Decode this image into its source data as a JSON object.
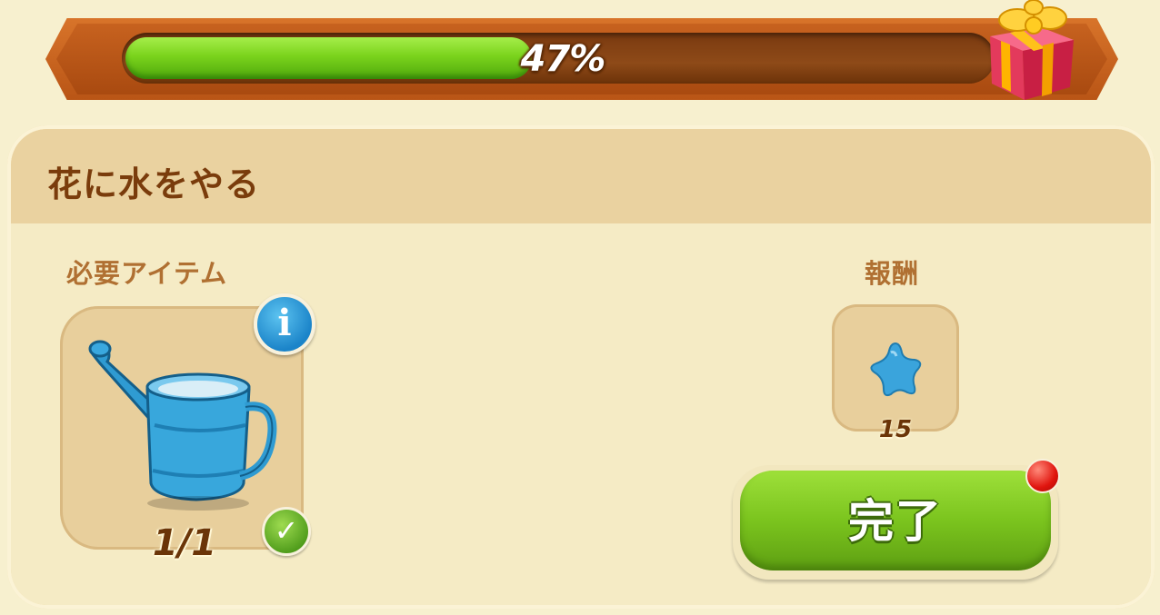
{
  "progress": {
    "value_percent": 47,
    "label": "47%",
    "fill_color": "#7ad31c",
    "reward_icon": "gift-box-icon"
  },
  "quest": {
    "title": "花に水をやる",
    "required_label": "必要アイテム",
    "required_item": {
      "icon": "watering-can-icon",
      "count_text": "1/1",
      "info_glyph": "i",
      "status_icon": "check-icon",
      "check_glyph": "✓"
    },
    "reward_label": "報酬",
    "reward": {
      "icon": "blue-star-icon",
      "amount": "15"
    },
    "complete_button_label": "完了",
    "notification_icon": "red-dot-icon"
  },
  "colors": {
    "background": "#f7f0cf",
    "header_frame": "#c7621f",
    "button_green": "#7bc41e",
    "title_brown": "#7a3c0c"
  }
}
